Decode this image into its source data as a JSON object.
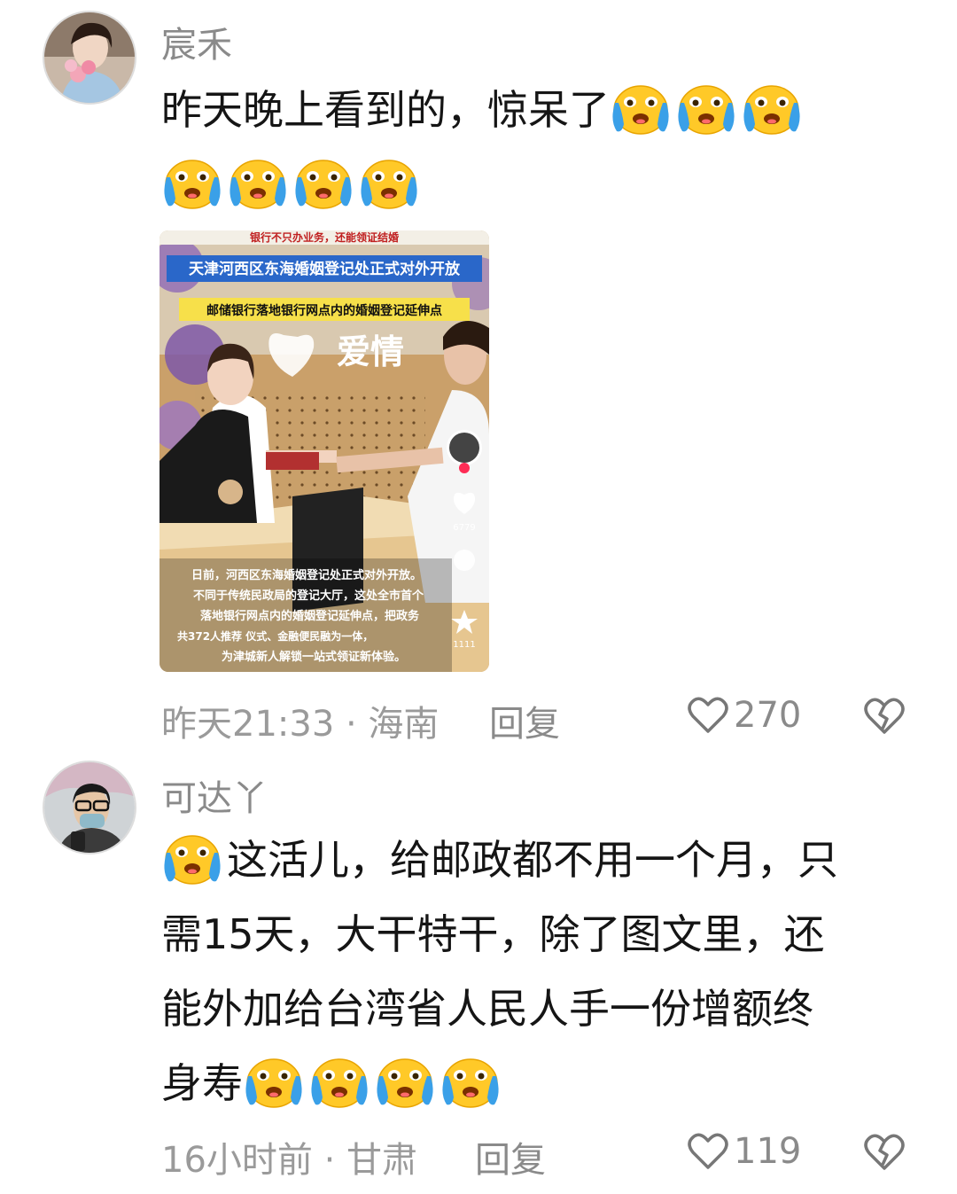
{
  "comments": [
    {
      "username": "宸禾",
      "text_line1": "昨天晚上看到的，惊呆了",
      "time_location": "昨天21:33 · 海南",
      "reply_label": "回复",
      "likes": "270",
      "emoji_name": "crying-face-icon"
    },
    {
      "username": "可达丫",
      "text_line1": "这活儿，给邮政都不用一个月，只",
      "text_line2": "需15天，大干特干，除了图文里，还",
      "text_line3": "能外加给台湾省人民人手一份增额终",
      "text_line4": "身寿",
      "time_location": "16小时前 · 甘肃",
      "reply_label": "回复",
      "likes": "119",
      "emoji_name": "crying-face-icon"
    }
  ],
  "thumbnail": {
    "top_caption": "银行不只办业务，还能领证结婚",
    "title": "天津河西区东海婚姻登记处正式对外开放",
    "subtitle": "邮储银行落地银行网点内的婚姻登记延伸点",
    "sign_text": "爱情",
    "side_like_count": "6779",
    "side_star_count": "1111",
    "caption_line1": "日前，河西区东海婚姻登记处正式对外开放。",
    "caption_line2": "不同于传统民政局的登记大厅，这处全市首个",
    "caption_line3": "落地银行网点内的婚姻登记延伸点，把政务",
    "caption_line4": "共372人推荐  仪式、金融便民融为一体，",
    "caption_line5": "为津城新人解锁一站式领证新体验。"
  },
  "colors": {
    "emoji_yellow": "#FFC928",
    "tear_blue": "#3AA0E8",
    "meta_gray": "#9a9a9a"
  }
}
